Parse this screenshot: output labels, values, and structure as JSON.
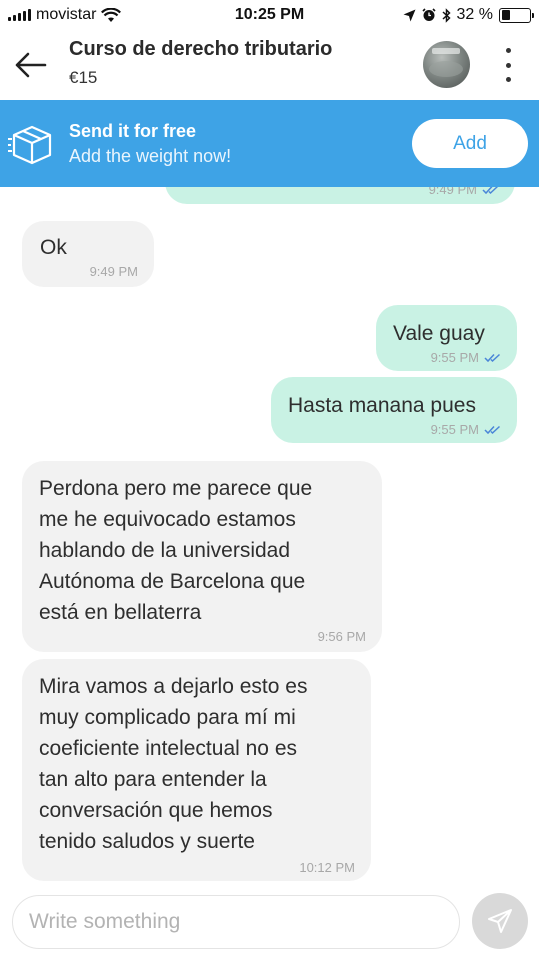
{
  "status_bar": {
    "carrier": "movistar",
    "time": "10:25 PM",
    "battery": "32 %",
    "battery_level": 0.32
  },
  "header": {
    "title": "Curso de derecho tributario",
    "price": "€15"
  },
  "promo": {
    "title": "Send it for free",
    "subtitle": "Add the weight now!",
    "button_label": "Add"
  },
  "messages": [
    {
      "direction": "outgoing",
      "text": "",
      "time": "9:49 PM",
      "read": true
    },
    {
      "direction": "incoming",
      "text": "Ok",
      "time": "9:49 PM"
    },
    {
      "direction": "outgoing",
      "text": "Vale guay",
      "time": "9:55 PM",
      "read": true
    },
    {
      "direction": "outgoing",
      "text": "Hasta manana pues",
      "time": "9:55 PM",
      "read": true
    },
    {
      "direction": "incoming",
      "lines": [
        "Perdona pero me parece que",
        "me he equivocado estamos",
        "hablando de la universidad",
        "Autónoma de Barcelona que",
        "está en bellaterra"
      ],
      "time": "9:56 PM"
    },
    {
      "direction": "incoming",
      "lines": [
        "Mira vamos a dejarlo esto es",
        "muy complicado para mí mi",
        "coeficiente intelectual no es",
        "tan alto para entender la",
        "conversación que hemos",
        "tenido saludos y suerte"
      ],
      "time": "10:12 PM"
    }
  ],
  "composer": {
    "placeholder": "Write something"
  },
  "colors": {
    "promo_bg": "#3ea3e6",
    "outgoing_bubble": "#c9f2e4",
    "incoming_bubble": "#f2f2f2",
    "read_ticks": "#4a86d8"
  },
  "icons": {
    "back": "arrow-left-icon",
    "menu": "more-vertical-icon",
    "promo": "package-box-icon",
    "send": "paper-plane-icon",
    "wifi": "wifi-icon",
    "location": "location-arrow-icon",
    "alarm": "alarm-clock-icon",
    "bluetooth": "bluetooth-icon"
  }
}
